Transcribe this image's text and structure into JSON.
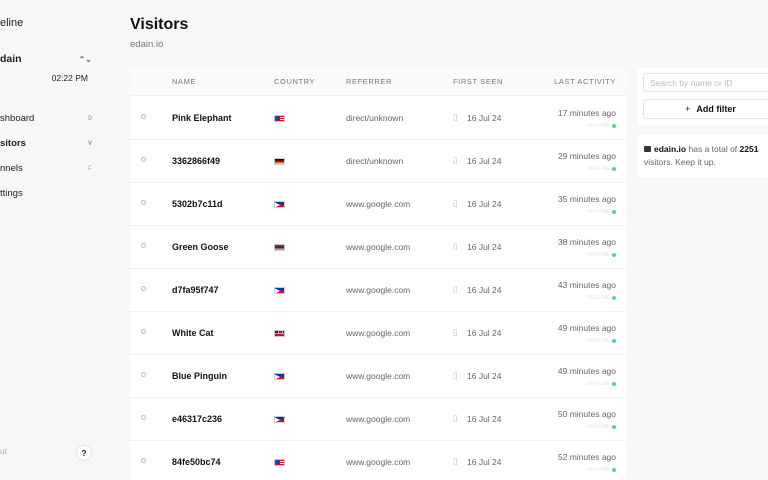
{
  "sidebar": {
    "app_name": "eline",
    "project": "dain",
    "time": "02:22 PM",
    "items": [
      {
        "label": "shboard",
        "key": "D"
      },
      {
        "label": "sitors",
        "key": "V"
      },
      {
        "label": "nnels",
        "key": "F"
      },
      {
        "label": "ttings",
        "key": ""
      }
    ],
    "logout": "ut",
    "help": "?"
  },
  "header": {
    "title": "Visitors",
    "subtitle": "edain.io"
  },
  "table": {
    "columns": [
      "NAME",
      "COUNTRY",
      "REFERRER",
      "FIRST SEEN",
      "LAST ACTIVITY"
    ],
    "rows": [
      {
        "name": "Pink Elephant",
        "country": "us",
        "referrer": "direct/unknown",
        "first_seen": "16 Jul 24",
        "last_activity": "17 minutes ago",
        "status": "OFFLINE"
      },
      {
        "name": "3362866f49",
        "country": "de",
        "referrer": "direct/unknown",
        "first_seen": "16 Jul 24",
        "last_activity": "29 minutes ago",
        "status": "OFFLINE"
      },
      {
        "name": "5302b7c11d",
        "country": "ph",
        "referrer": "www.google.com",
        "first_seen": "16 Jul 24",
        "last_activity": "35 minutes ago",
        "status": "OFFLINE"
      },
      {
        "name": "Green Goose",
        "country": "am",
        "referrer": "www.google.com",
        "first_seen": "16 Jul 24",
        "last_activity": "38 minutes ago",
        "status": "OFFLINE"
      },
      {
        "name": "d7fa95f747",
        "country": "ph",
        "referrer": "www.google.com",
        "first_seen": "16 Jul 24",
        "last_activity": "43 minutes ago",
        "status": "OFFLINE"
      },
      {
        "name": "White Cat",
        "country": "gb",
        "referrer": "www.google.com",
        "first_seen": "16 Jul 24",
        "last_activity": "49 minutes ago",
        "status": "OFFLINE"
      },
      {
        "name": "Blue Pinguin",
        "country": "ph",
        "referrer": "www.google.com",
        "first_seen": "16 Jul 24",
        "last_activity": "49 minutes ago",
        "status": "OFFLINE"
      },
      {
        "name": "e46317c236",
        "country": "ph",
        "referrer": "www.google.com",
        "first_seen": "16 Jul 24",
        "last_activity": "50 minutes ago",
        "status": "OFFLINE"
      },
      {
        "name": "84fe50bc74",
        "country": "us",
        "referrer": "www.google.com",
        "first_seen": "16 Jul 24",
        "last_activity": "52 minutes ago",
        "status": "OFFLINE"
      }
    ]
  },
  "filters": {
    "search_placeholder": "Search by name or ID",
    "add_filter_label": "Add filter"
  },
  "info": {
    "site": "edain.io",
    "text_before": "has a total of",
    "total": "2251",
    "text_after": "visitors. Keep it up."
  },
  "colors": {
    "online_dot": "#4ade80",
    "background": "#f7f7f7"
  }
}
